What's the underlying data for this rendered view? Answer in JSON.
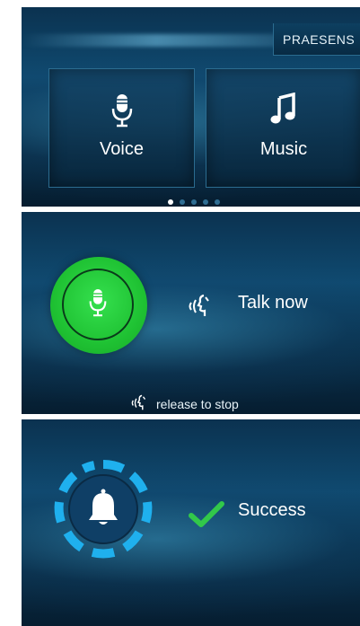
{
  "home": {
    "tab_label": "PRAESENS",
    "tiles": [
      {
        "label": "Voice",
        "icon": "microphone-icon"
      },
      {
        "label": "Music",
        "icon": "music-note-icon"
      }
    ],
    "page_indicator": {
      "total": 5,
      "active": 1
    }
  },
  "listening": {
    "button_icon": "microphone-icon",
    "prompt_icon": "speaking-head-icon",
    "prompt": "Talk now",
    "hint_icon": "speaking-head-icon",
    "hint": "release to stop",
    "accent_color": "#22c83a"
  },
  "result": {
    "button_icon": "bell-icon",
    "status_icon": "checkmark-icon",
    "status": "Success",
    "accent_color": "#1fb0ee",
    "check_color": "#32c84a"
  }
}
